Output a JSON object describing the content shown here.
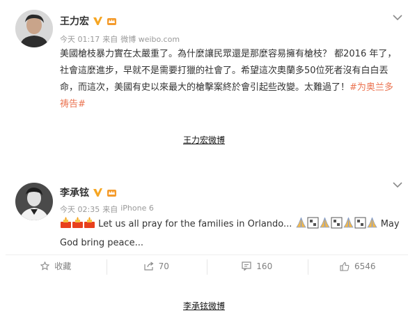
{
  "posts": [
    {
      "username": "王力宏",
      "meta_time": "今天 01:17",
      "meta_via": "来自",
      "meta_source": "微博 weibo.com",
      "text": "美國槍枝暴力實在太嚴重了。為什麼讓民眾還是那麼容易擁有槍枝？ 都2016 年了，社會這麼進步，早就不是需要打獵的社會了。希望這次奧蘭多50位死者沒有白白丟命，而這次，美國有史以來最大的槍擊案終於會引起些改變。太難過了！",
      "hashtag": "#为奥兰多祷告#",
      "caption": "王力宏微博"
    },
    {
      "username": "李承铉",
      "meta_time": "今天 02:35",
      "meta_via": "来自",
      "meta_source": "iPhone 6",
      "text": "Let us all pray for the families in Orlando...",
      "text_end": "May God bring peace...",
      "actions": {
        "favorite": "收藏",
        "repost": "70",
        "comment": "160",
        "like": "6546"
      },
      "caption": "李承铉微博"
    }
  ],
  "colors": {
    "hashtag": "#eb7350",
    "verified": "#f6a623",
    "meta": "#999999"
  },
  "icons": [
    "verified-v-icon",
    "vip-crown-icon",
    "chevron-down-icon",
    "candle-emoji",
    "pray-emoji",
    "star-icon",
    "repost-icon",
    "comment-icon",
    "thumbs-up-icon"
  ]
}
